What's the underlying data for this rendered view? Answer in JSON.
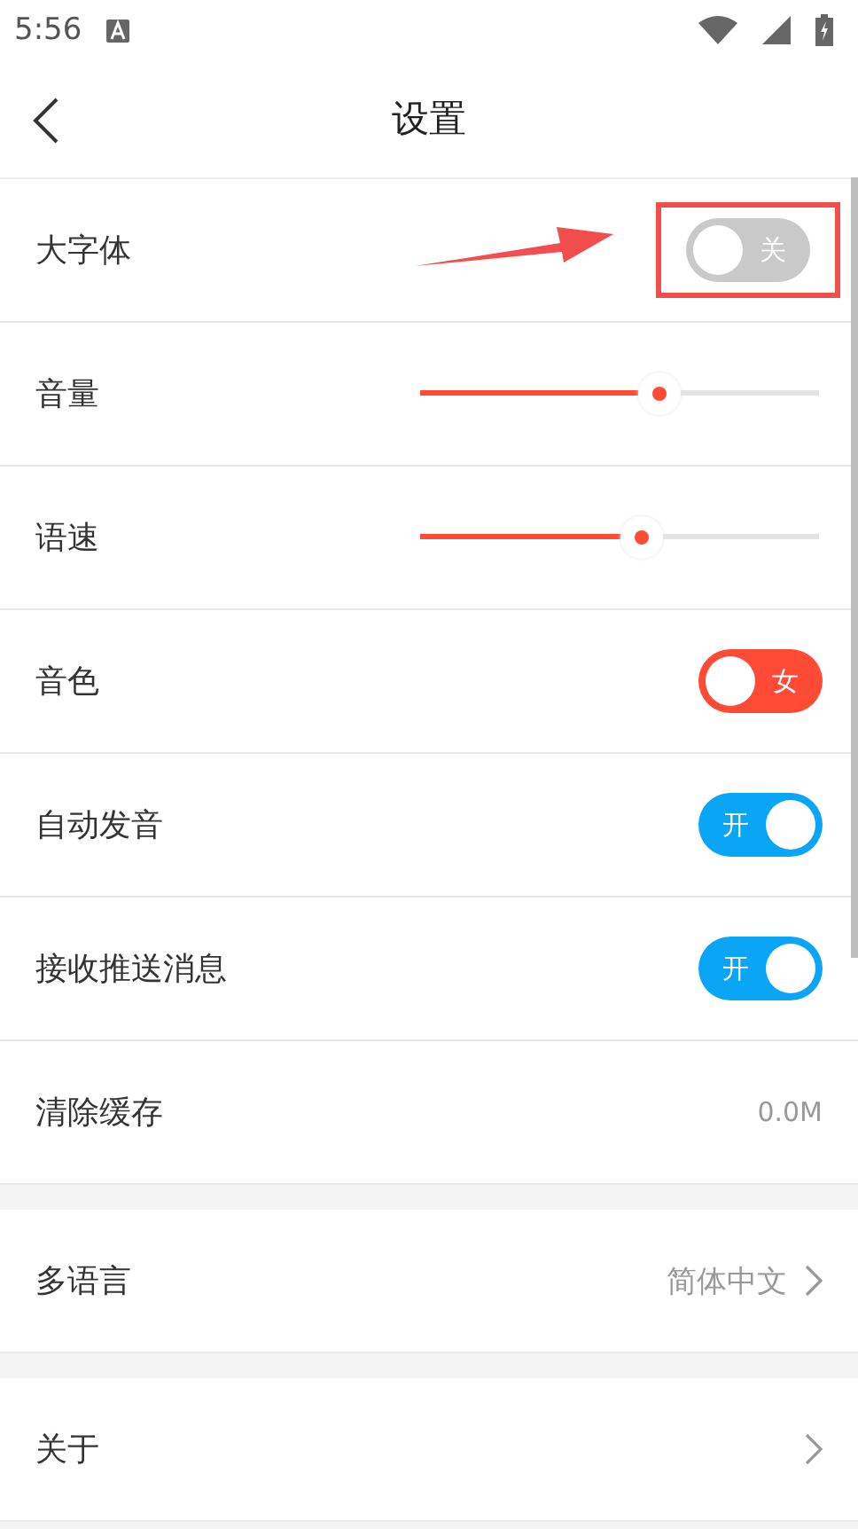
{
  "status_bar": {
    "time": "5:56"
  },
  "header": {
    "title": "设置"
  },
  "sections": [
    {
      "items": [
        {
          "kind": "toggle",
          "label": "大字体",
          "on": false,
          "switch_text": "关",
          "highlighted": true
        },
        {
          "kind": "slider",
          "label": "音量",
          "level": 0.6
        },
        {
          "kind": "slider",
          "label": "语速",
          "level": 0.555
        },
        {
          "kind": "toggle",
          "label": "音色",
          "on": false,
          "switch_text": "女",
          "color": "#ff4a35"
        },
        {
          "kind": "toggle",
          "label": "自动发音",
          "on": true,
          "switch_text": "开",
          "color": "#0aa5f5"
        },
        {
          "kind": "toggle",
          "label": "接收推送消息",
          "on": true,
          "switch_text": "开",
          "color": "#0aa5f5"
        },
        {
          "kind": "value",
          "label": "清除缓存",
          "value": "0.0M"
        }
      ]
    },
    {
      "items": [
        {
          "kind": "link",
          "label": "多语言",
          "value": "简体中文"
        }
      ]
    },
    {
      "items": [
        {
          "kind": "link",
          "label": "关于"
        }
      ]
    }
  ]
}
